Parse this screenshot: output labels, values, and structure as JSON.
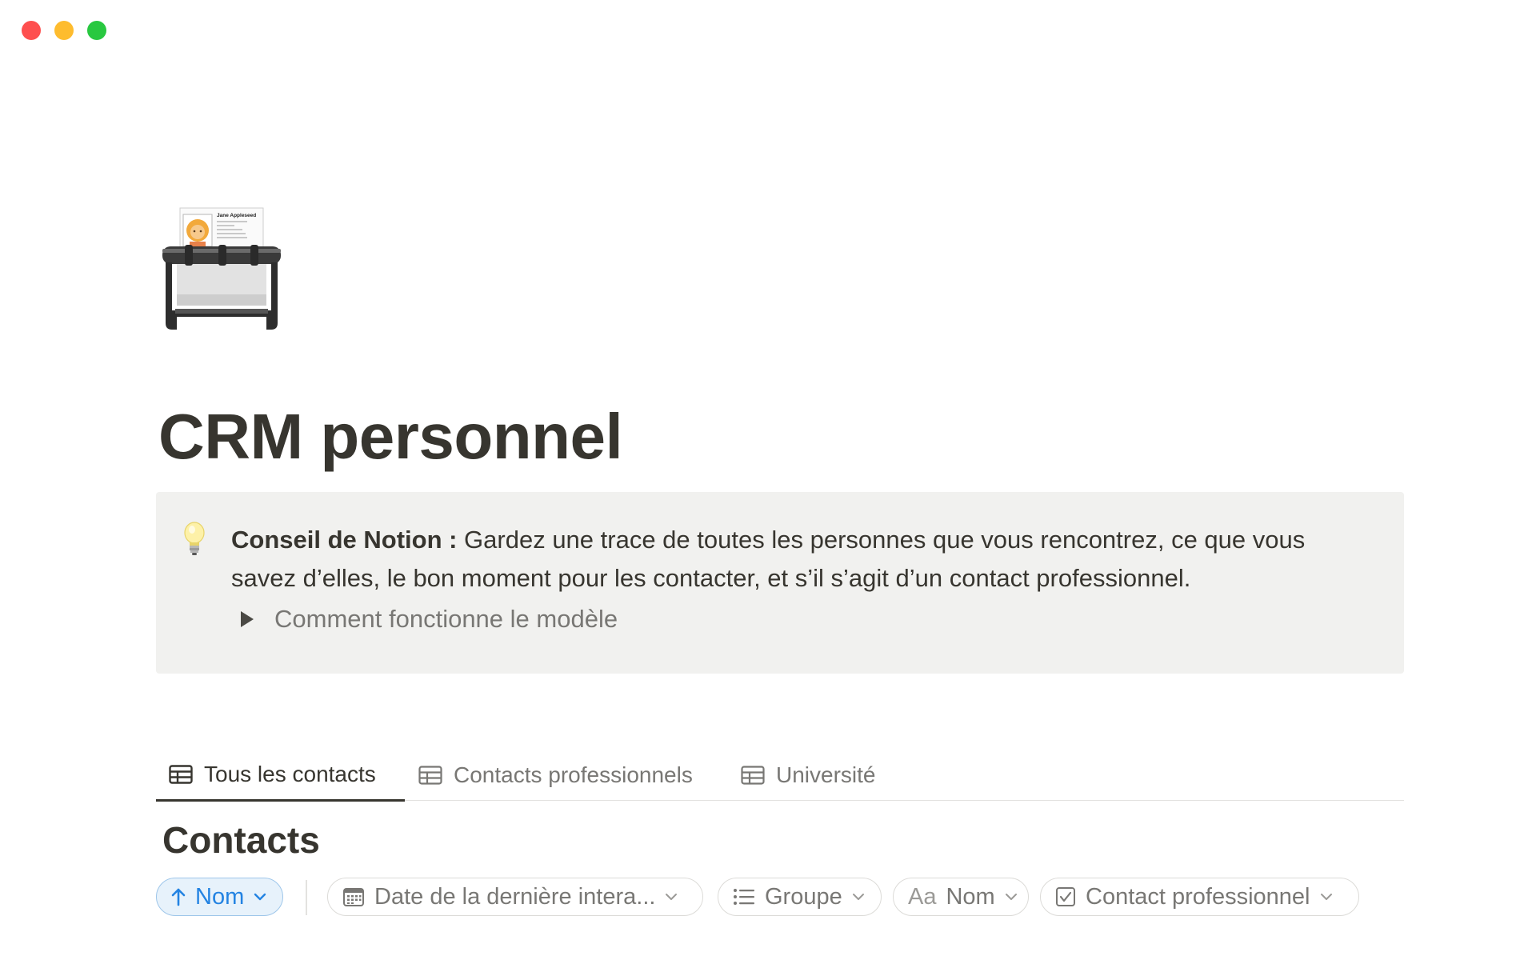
{
  "window": {
    "controls": [
      "close",
      "minimize",
      "maximize"
    ]
  },
  "page": {
    "icon": "rolodex-icon",
    "icon_card": {
      "name": "Jane Appleseed"
    },
    "title": "CRM personnel"
  },
  "callout": {
    "icon": "lightbulb-icon",
    "bold": "Conseil de Notion :",
    "text": " Gardez une trace de toutes les personnes que vous rencontrez, ce que vous savez d’elles, le bon moment pour les contacter, et s’il s’agit d’un contact professionnel.",
    "toggle_label": "Comment fonctionne le modèle"
  },
  "tabs": [
    {
      "label": "Tous les contacts",
      "icon": "table-icon",
      "active": true
    },
    {
      "label": "Contacts professionnels",
      "icon": "table-icon",
      "active": false
    },
    {
      "label": "Université",
      "icon": "table-icon",
      "active": false
    }
  ],
  "database": {
    "title": "Contacts"
  },
  "filters": {
    "sort": {
      "label": "Nom",
      "icon": "arrow-up-icon"
    },
    "chips": [
      {
        "label": "Date de la dernière intera...",
        "icon": "calendar-icon"
      },
      {
        "label": "Groupe",
        "icon": "list-icon"
      },
      {
        "label": "Nom",
        "prefix": "Aa",
        "icon": "text-icon"
      },
      {
        "label": "Contact professionnel",
        "icon": "checkbox-icon"
      }
    ]
  },
  "colors": {
    "text": "#37352f",
    "muted": "#787774",
    "callout_bg": "#f1f1ef",
    "accent": "#2383e2"
  }
}
